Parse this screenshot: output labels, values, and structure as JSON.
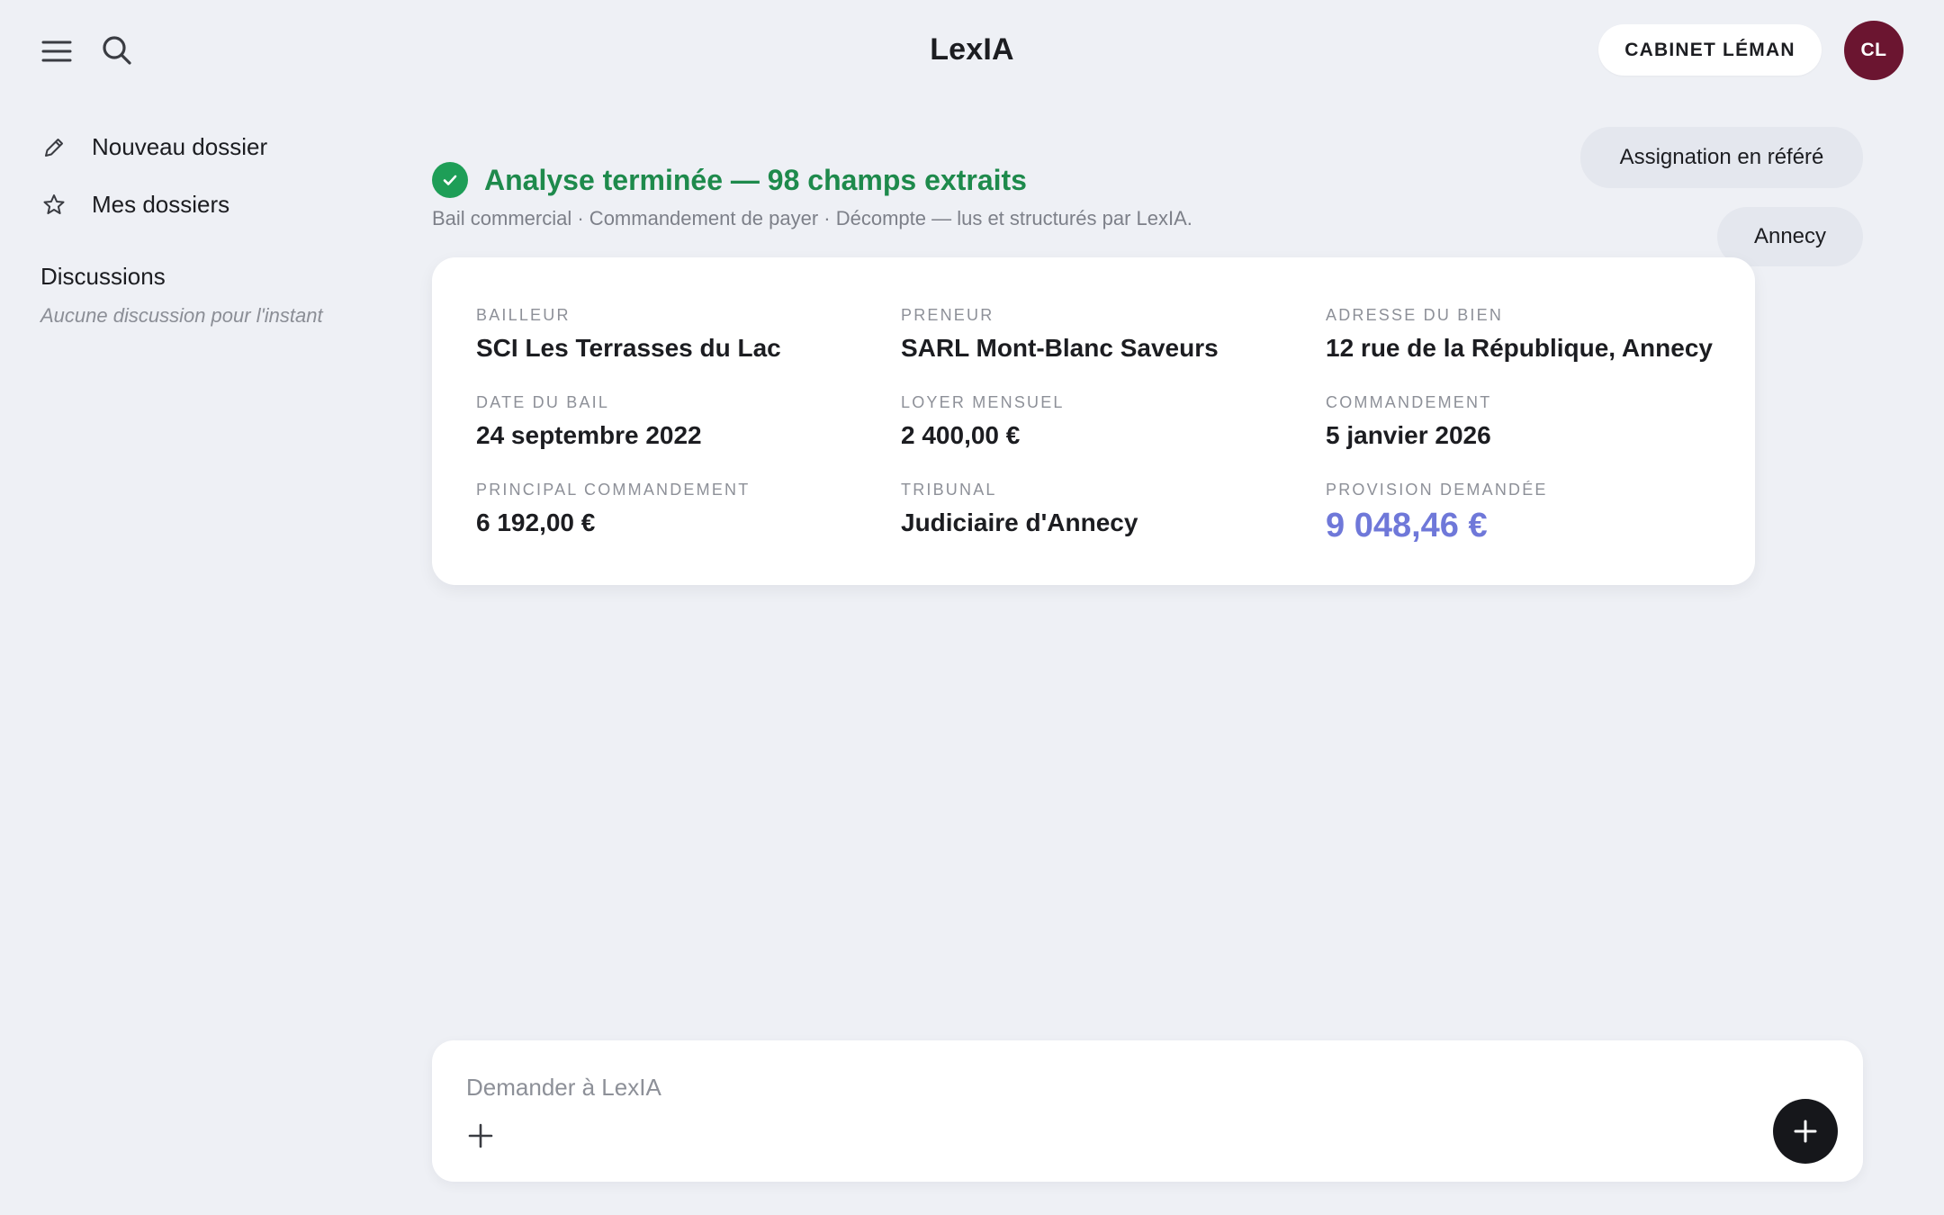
{
  "header": {
    "app_title": "LexIA",
    "firm_label": "CABINET LÉMAN",
    "avatar_initials": "CL",
    "avatar_color": "#6b1530"
  },
  "icons": {
    "menu": "hamburger-icon",
    "search": "search-icon",
    "new": "pencil-icon",
    "favorites": "star-icon",
    "status": "check-icon",
    "attach": "plus-icon",
    "send": "plus-icon"
  },
  "sidebar": {
    "items": [
      {
        "label": "Nouveau dossier"
      },
      {
        "label": "Mes dossiers"
      }
    ],
    "discussions_heading": "Discussions",
    "discussions_empty": "Aucune discussion pour l'instant"
  },
  "status": {
    "title": "Analyse terminée — 98 champs extraits",
    "subtitle": "Bail commercial · Commandement de payer · Décompte — lus et structurés par LexIA.",
    "color": "#1e8a4c"
  },
  "chips": [
    {
      "label": "Assignation en référé"
    },
    {
      "label": "Annecy"
    }
  ],
  "fields": [
    {
      "label": "BAILLEUR",
      "value": "SCI Les Terrasses du Lac"
    },
    {
      "label": "PRENEUR",
      "value": "SARL Mont-Blanc Saveurs"
    },
    {
      "label": "ADRESSE DU BIEN",
      "value": "12 rue de la République, Annecy"
    },
    {
      "label": "DATE DU BAIL",
      "value": "24 septembre 2022"
    },
    {
      "label": "LOYER MENSUEL",
      "value": "2 400,00 €"
    },
    {
      "label": "COMMANDEMENT",
      "value": "5 janvier 2026"
    },
    {
      "label": "PRINCIPAL COMMANDEMENT",
      "value": "6 192,00 €"
    },
    {
      "label": "TRIBUNAL",
      "value": "Judiciaire d'Annecy"
    },
    {
      "label": "PROVISION DEMANDÉE",
      "value": "9 048,46 €",
      "accent_color": "#6f78d9"
    }
  ],
  "composer": {
    "placeholder": "Demander à LexIA",
    "value": ""
  }
}
